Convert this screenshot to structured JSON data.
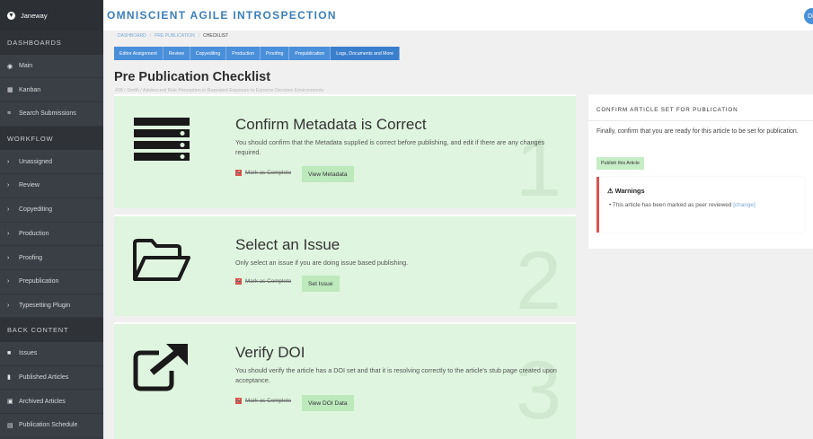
{
  "sidebar": {
    "brand": "Janeway",
    "sections": {
      "dashboards": "DASHBOARDS",
      "workflow": "WORKFLOW",
      "back_content": "BACK CONTENT"
    },
    "dashboards_items": [
      {
        "label": "Main",
        "icon": "dashboard-icon"
      },
      {
        "label": "Kanban",
        "icon": "kanban-icon"
      },
      {
        "label": "Search Submissions",
        "icon": "list-icon"
      }
    ],
    "workflow_items": [
      {
        "label": "Unassigned"
      },
      {
        "label": "Review"
      },
      {
        "label": "Copyediting"
      },
      {
        "label": "Production"
      },
      {
        "label": "Proofing"
      },
      {
        "label": "Prepublication"
      },
      {
        "label": "Typesetting Plugin"
      }
    ],
    "back_items": [
      {
        "label": "Issues",
        "icon": "folder-icon"
      },
      {
        "label": "Published Articles",
        "icon": "file-icon"
      },
      {
        "label": "Archived Articles",
        "icon": "archive-icon"
      },
      {
        "label": "Publication Schedule",
        "icon": "calendar-icon"
      }
    ]
  },
  "header": {
    "press_title": "OMNISCIENT AGILE INTROSPECTION",
    "avatar_initials": "DK"
  },
  "breadcrumb": {
    "items": [
      "DASHBOARD",
      "PRE PUBLICATION",
      "CHECKLIST"
    ]
  },
  "tabs": [
    {
      "label": "Editor Assignment"
    },
    {
      "label": "Review"
    },
    {
      "label": "Copyediting"
    },
    {
      "label": "Production"
    },
    {
      "label": "Proofing"
    },
    {
      "label": "Prepublication"
    },
    {
      "label": "Logs, Documents and More"
    }
  ],
  "page": {
    "title": "Pre Publication Checklist",
    "subtitle": "#28 / Smith / Adolescent Risk Perception in Repeated Exposure to Extreme Decision Environments"
  },
  "checklist": [
    {
      "number": "1",
      "title": "Confirm Metadata is Correct",
      "description": "You should confirm that the Metadata supplied is correct before publishing, and edit if there are any changes required.",
      "mark_label": "Mark as Complete",
      "button_label": "View Metadata",
      "icon": "server-icon"
    },
    {
      "number": "2",
      "title": "Select an Issue",
      "description": "Only select an issue if you are doing issue based publishing.",
      "mark_label": "Mark as Complete",
      "button_label": "Set Issue",
      "icon": "folder-open-icon"
    },
    {
      "number": "3",
      "title": "Verify DOI",
      "description": "You should verify the article has a DOI set and that it is resolving correctly to the article's stub page created upon acceptance.",
      "mark_label": "Mark as Complete",
      "button_label": "View DOI Data",
      "icon": "external-link-icon"
    }
  ],
  "publish_panel": {
    "title": "CONFIRM ARTICLE SET FOR PUBLICATION",
    "text": "Finally, confirm that you are ready for this article to be set for publication.",
    "button_label": "Publish this Article",
    "warnings_title": "Warnings",
    "warning_text": "This article has been marked as peer reviewed",
    "warning_link": "[change]"
  },
  "colors": {
    "sidebar_bg": "#3a3f45",
    "accent_blue": "#4a8fd9",
    "card_green": "#dff5df",
    "button_green": "#bde9bd",
    "warning_red": "#d9534f"
  }
}
